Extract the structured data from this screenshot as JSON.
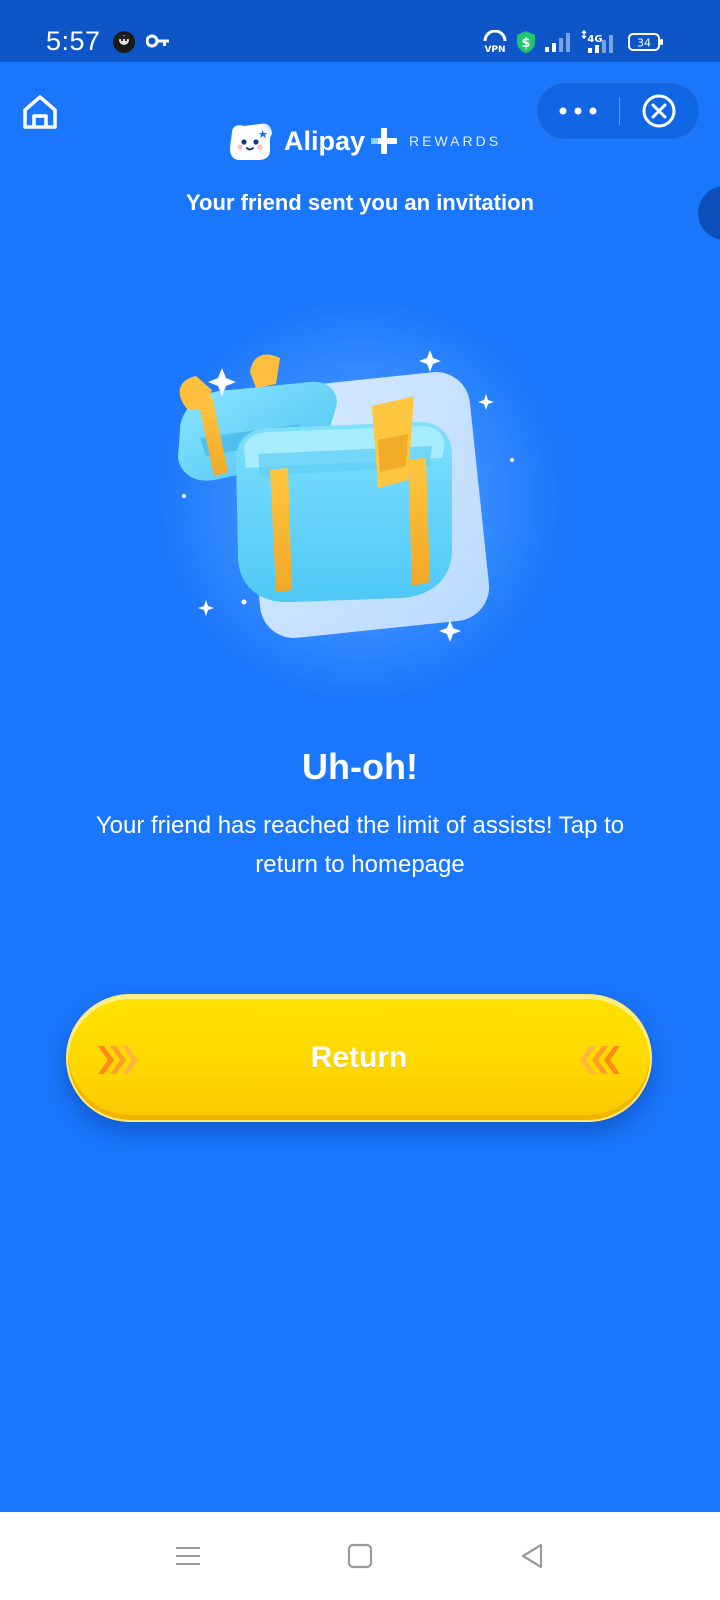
{
  "status_bar": {
    "time": "5:57",
    "network": "4G",
    "battery": "34"
  },
  "header": {
    "brand": "Alipay",
    "brand_suffix": "REWARDS",
    "subtitle": "Your friend sent you an invitation"
  },
  "content": {
    "title": "Uh-oh!",
    "message": "Your friend has reached the limit of assists! Tap to return to homepage"
  },
  "actions": {
    "return_label": "Return"
  },
  "colors": {
    "background": "#1a76fb",
    "status_bar": "#0e56c8",
    "button": "#ffd900",
    "chevrons": "#ff9a1f"
  },
  "icons": {
    "home": "home-icon",
    "more": "more-icon",
    "close": "close-circle-icon",
    "nav_menu": "menu-icon",
    "nav_home": "square-icon",
    "nav_back": "back-triangle-icon"
  }
}
